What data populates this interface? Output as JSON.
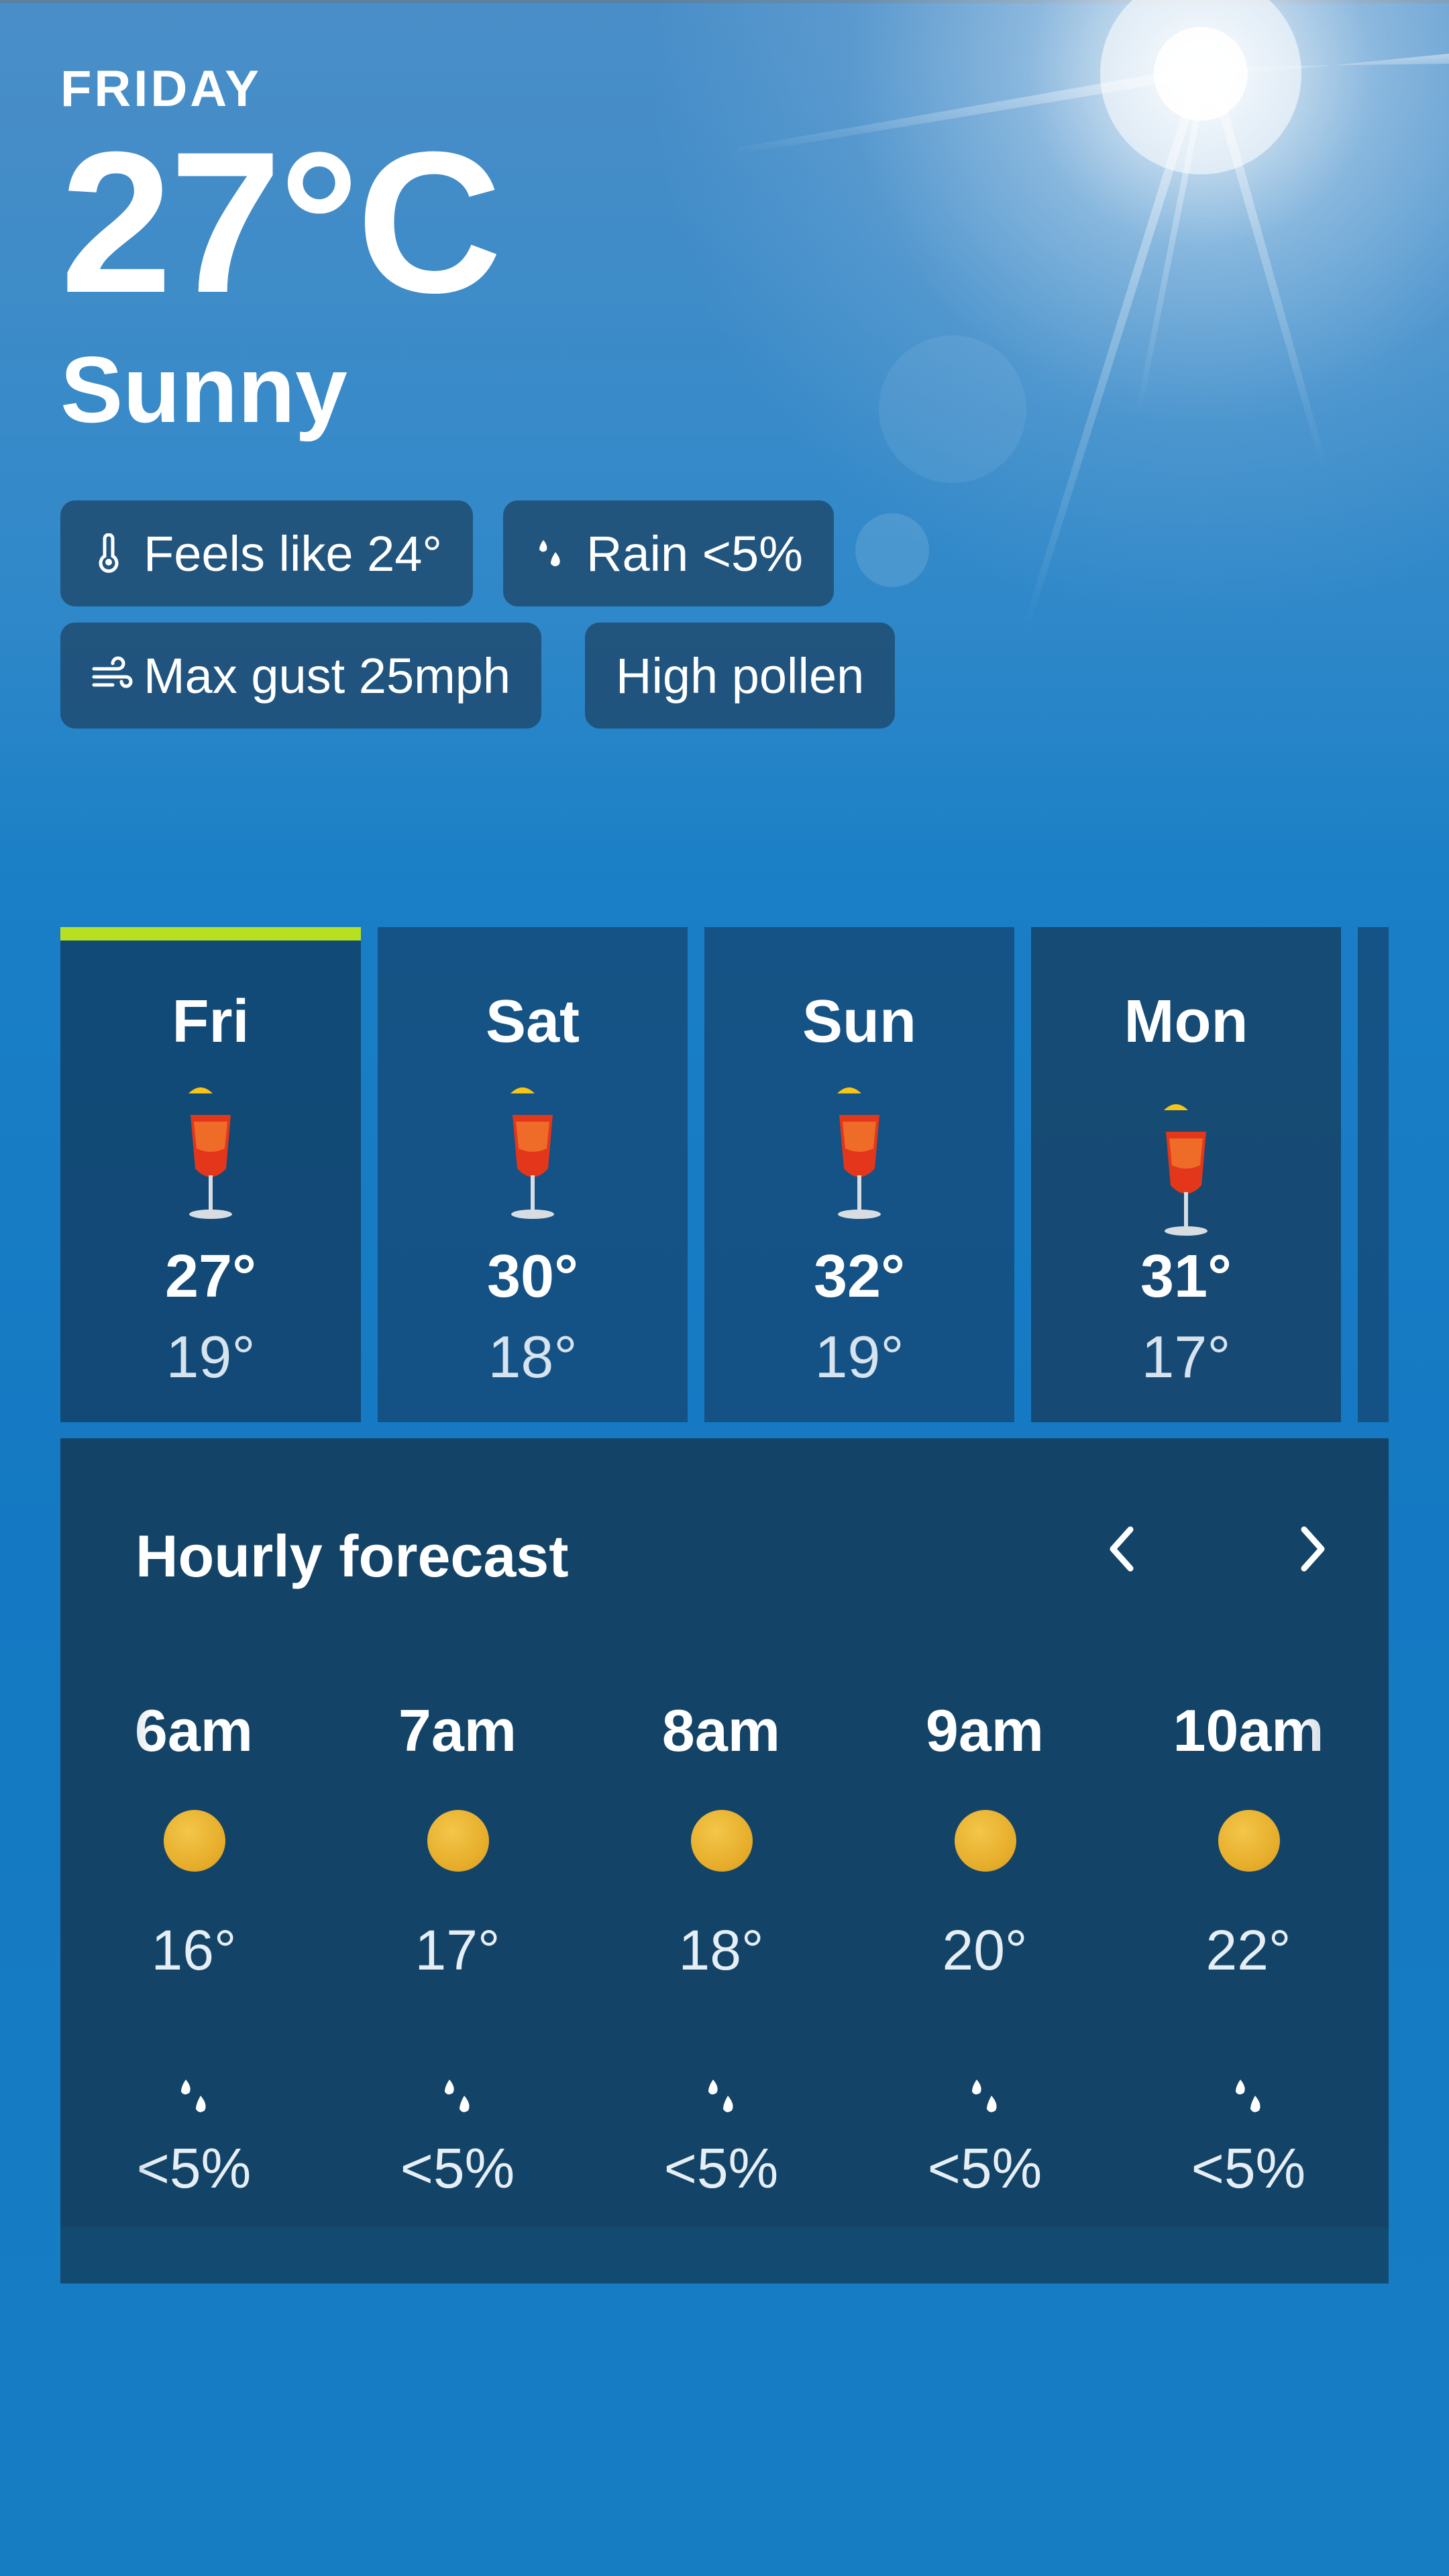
{
  "current": {
    "day": "FRIDAY",
    "temperature": "27°C",
    "condition": "Sunny"
  },
  "pills": {
    "feels_like": "Feels like 24°",
    "rain": "Rain <5%",
    "gust": "Max gust 25mph",
    "pollen": "High pollen"
  },
  "days": [
    {
      "name": "Fri",
      "high": "27°",
      "low": "19°",
      "icon": "cocktail-icon"
    },
    {
      "name": "Sat",
      "high": "30°",
      "low": "18°",
      "icon": "cocktail-icon"
    },
    {
      "name": "Sun",
      "high": "32°",
      "low": "19°",
      "icon": "cocktail-icon"
    },
    {
      "name": "Mon",
      "high": "31°",
      "low": "17°",
      "icon": "cocktail-icon"
    }
  ],
  "selected_bar_color": "#b7e021",
  "hourly": {
    "title": "Hourly forecast",
    "prev_icon": "chevron-left-icon",
    "next_icon": "chevron-right-icon",
    "hours": [
      {
        "time": "6am",
        "temp": "16°",
        "rain": "<5%",
        "icon": "sun-icon"
      },
      {
        "time": "7am",
        "temp": "17°",
        "rain": "<5%",
        "icon": "sun-icon"
      },
      {
        "time": "8am",
        "temp": "18°",
        "rain": "<5%",
        "icon": "sun-icon"
      },
      {
        "time": "9am",
        "temp": "20°",
        "rain": "<5%",
        "icon": "sun-icon"
      },
      {
        "time": "10am",
        "temp": "22°",
        "rain": "<5%",
        "icon": "sun-icon"
      }
    ]
  }
}
